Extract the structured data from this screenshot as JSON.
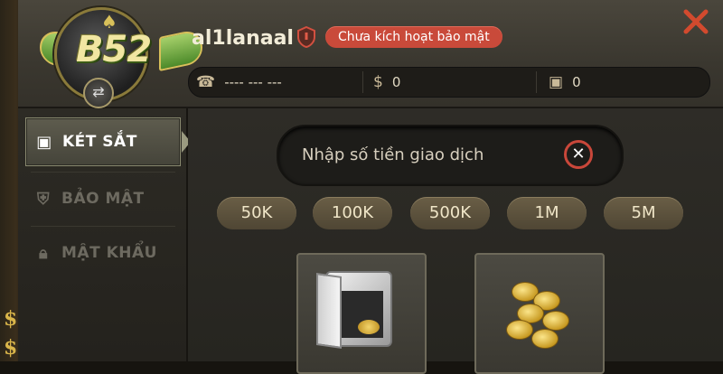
{
  "profile": {
    "username": "al1lanaal",
    "security_status": "Chưa kích hoạt bảo mật",
    "logo_text": "B52"
  },
  "stats": {
    "phone": "---- --- ---",
    "money": "0",
    "safe": "0"
  },
  "sidebar": {
    "items": [
      {
        "label": "KÉT SẮT",
        "icon": "safe-icon",
        "active": true
      },
      {
        "label": "BẢO MẬT",
        "icon": "shield-icon",
        "active": false
      },
      {
        "label": "MẬT KHẨU",
        "icon": "lock-icon",
        "active": false
      }
    ]
  },
  "transaction": {
    "placeholder": "Nhập số tiền giao dịch",
    "amounts": [
      "50K",
      "100K",
      "500K",
      "1M",
      "5M"
    ]
  },
  "colors": {
    "accent_red": "#c94a3a",
    "active_tab": "#5e5c4e",
    "chip": "#5e5440"
  }
}
